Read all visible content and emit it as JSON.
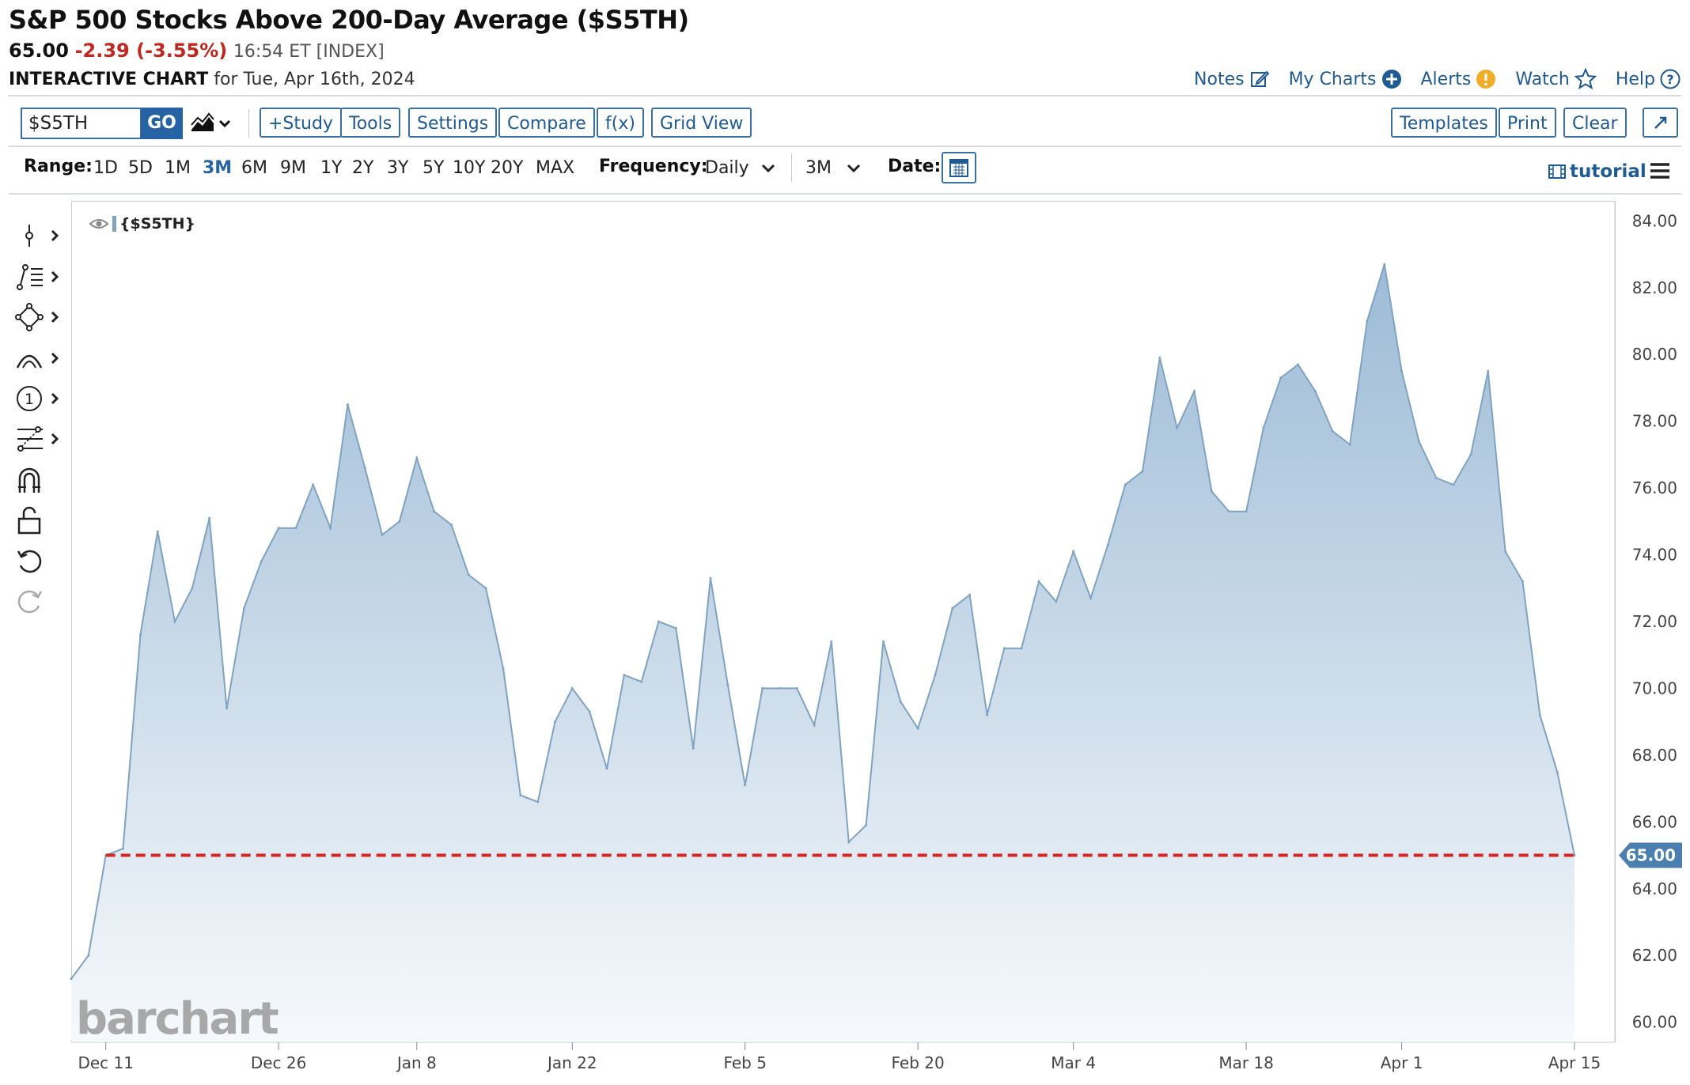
{
  "header": {
    "title": "S&P 500 Stocks Above 200-Day Average ($S5TH)",
    "last": "65.00",
    "change": "-2.39 (-3.55%)",
    "time": "16:54 ET [INDEX]",
    "subtitle_bold": "INTERACTIVE CHART",
    "subtitle_rest": "for Tue, Apr 16th, 2024"
  },
  "toplinks": {
    "notes": "Notes",
    "mycharts": "My Charts",
    "alerts": "Alerts",
    "watch": "Watch",
    "help": "Help"
  },
  "toolbar": {
    "symbol_value": "$S5TH",
    "go": "GO",
    "study": "+Study",
    "tools": "Tools",
    "settings": "Settings",
    "compare": "Compare",
    "fx": "f(x)",
    "gridview": "Grid View",
    "templates": "Templates",
    "print": "Print",
    "clear": "Clear"
  },
  "rangebar": {
    "range_label": "Range:",
    "ranges": [
      "1D",
      "5D",
      "1M",
      "3M",
      "6M",
      "9M",
      "1Y",
      "2Y",
      "3Y",
      "5Y",
      "10Y",
      "20Y",
      "MAX"
    ],
    "active_range": "3M",
    "frequency_label": "Frequency:",
    "frequency": "Daily",
    "period": "3M",
    "date_label": "Date:",
    "tutorial": "tutorial"
  },
  "left_tools": [
    "crosshair-icon",
    "trendline-icon",
    "shapes-icon",
    "arc-icon",
    "annotation-number-icon",
    "fibonacci-icon",
    "magnet-icon",
    "unlock-icon",
    "undo-icon",
    "redo-icon"
  ],
  "chart_data": {
    "type": "area",
    "legend": "{$S5TH}",
    "watermark": "barchart",
    "ylim": [
      59.4,
      84.6
    ],
    "yticks": [
      "60.00",
      "62.00",
      "64.00",
      "66.00",
      "68.00",
      "70.00",
      "72.00",
      "74.00",
      "76.00",
      "78.00",
      "80.00",
      "82.00",
      "84.00"
    ],
    "xticks": [
      "Dec 11",
      "Dec 26",
      "Jan 8",
      "Jan 22",
      "Feb 5",
      "Feb 20",
      "Mar 4",
      "Mar 18",
      "Apr 1",
      "Apr 15"
    ],
    "x": [
      "Dec 7",
      "Dec 8",
      "Dec 11",
      "Dec 12",
      "Dec 13",
      "Dec 14",
      "Dec 15",
      "Dec 18",
      "Dec 19",
      "Dec 20",
      "Dec 21",
      "Dec 22",
      "Dec 26",
      "Dec 27",
      "Dec 28",
      "Dec 29",
      "Jan 2",
      "Jan 3",
      "Jan 4",
      "Jan 5",
      "Jan 8",
      "Jan 9",
      "Jan 10",
      "Jan 11",
      "Jan 12",
      "Jan 16",
      "Jan 17",
      "Jan 18",
      "Jan 19",
      "Jan 22",
      "Jan 23",
      "Jan 24",
      "Jan 25",
      "Jan 26",
      "Jan 29",
      "Jan 30",
      "Jan 31",
      "Feb 1",
      "Feb 2",
      "Feb 5",
      "Feb 6",
      "Feb 7",
      "Feb 8",
      "Feb 9",
      "Feb 12",
      "Feb 13",
      "Feb 14",
      "Feb 15",
      "Feb 16",
      "Feb 20",
      "Feb 21",
      "Feb 22",
      "Feb 23",
      "Feb 26",
      "Feb 27",
      "Feb 28",
      "Feb 29",
      "Mar 1",
      "Mar 4",
      "Mar 5",
      "Mar 6",
      "Mar 7",
      "Mar 8",
      "Mar 11",
      "Mar 12",
      "Mar 13",
      "Mar 14",
      "Mar 15",
      "Mar 18",
      "Mar 19",
      "Mar 20",
      "Mar 21",
      "Mar 22",
      "Mar 25",
      "Mar 26",
      "Mar 27",
      "Mar 28",
      "Apr 1",
      "Apr 2",
      "Apr 3",
      "Apr 4",
      "Apr 5",
      "Apr 8",
      "Apr 9",
      "Apr 10",
      "Apr 11",
      "Apr 12",
      "Apr 15",
      "Apr 16"
    ],
    "y": [
      61.3,
      62.0,
      65.0,
      65.2,
      71.6,
      74.7,
      72.0,
      73.0,
      75.1,
      69.4,
      72.4,
      73.8,
      74.8,
      74.8,
      76.1,
      74.8,
      78.5,
      76.6,
      74.6,
      75.0,
      76.9,
      75.3,
      74.9,
      73.4,
      73.0,
      70.6,
      66.8,
      66.6,
      69.0,
      70.0,
      69.3,
      67.6,
      70.4,
      70.2,
      72.0,
      71.8,
      68.2,
      73.3,
      70.1,
      67.1,
      70.0,
      70.0,
      70.0,
      68.9,
      71.4,
      65.4,
      65.9,
      71.4,
      69.6,
      68.8,
      70.4,
      72.4,
      72.8,
      69.2,
      71.2,
      71.2,
      73.2,
      72.6,
      74.1,
      72.7,
      74.3,
      76.1,
      76.5,
      79.9,
      77.8,
      78.9,
      75.9,
      75.3,
      75.3,
      77.8,
      79.3,
      79.7,
      78.9,
      77.7,
      77.3,
      81.0,
      82.7,
      79.5,
      77.4,
      76.3,
      76.1,
      77.0,
      79.5,
      74.1,
      73.2,
      69.2,
      67.5,
      65.0
    ],
    "last_price": "65.00",
    "reference_level": 65.0,
    "line_color": "#7fa3c0",
    "fill_top_color": "#9dbbd6",
    "fill_bottom_color": "#f6f9fc",
    "reference_color": "#d42626",
    "grid": false
  }
}
